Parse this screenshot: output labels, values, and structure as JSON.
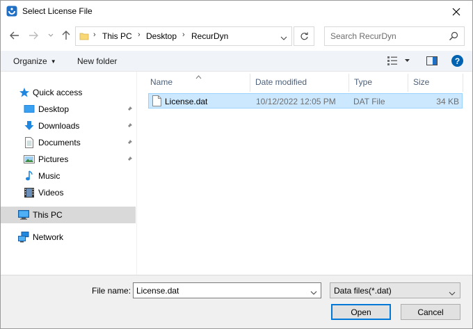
{
  "window": {
    "title": "Select License File"
  },
  "address": {
    "breadcrumbs": [
      "This PC",
      "Desktop",
      "RecurDyn"
    ]
  },
  "search": {
    "placeholder": "Search RecurDyn"
  },
  "toolbar": {
    "organize_label": "Organize",
    "new_folder_label": "New folder",
    "help_label": "?"
  },
  "sidebar": {
    "items": [
      {
        "label": "Quick access",
        "icon": "star-icon"
      },
      {
        "label": "Desktop",
        "icon": "desktop-icon",
        "pinned": true
      },
      {
        "label": "Downloads",
        "icon": "download-arrow-icon",
        "pinned": true
      },
      {
        "label": "Documents",
        "icon": "document-icon",
        "pinned": true
      },
      {
        "label": "Pictures",
        "icon": "picture-icon",
        "pinned": true
      },
      {
        "label": "Music",
        "icon": "music-note-icon"
      },
      {
        "label": "Videos",
        "icon": "film-icon"
      },
      {
        "label": "This PC",
        "icon": "computer-icon",
        "selected": true
      },
      {
        "label": "Network",
        "icon": "network-icon"
      }
    ]
  },
  "filelist": {
    "columns": [
      "Name",
      "Date modified",
      "Type",
      "Size"
    ],
    "rows": [
      {
        "name": "License.dat",
        "date_modified": "10/12/2022 12:05 PM",
        "type": "DAT File",
        "size": "34 KB",
        "selected": true
      }
    ]
  },
  "bottom": {
    "file_name_label": "File name:",
    "file_name_value": "License.dat",
    "file_type_value": "Data files(*.dat)",
    "open_label": "Open",
    "cancel_label": "Cancel"
  },
  "colors": {
    "selection_bg": "#cce8ff",
    "selection_border": "#99d1ff",
    "accent": "#0078d7",
    "nav_selected_bg": "#d9d9d9"
  }
}
